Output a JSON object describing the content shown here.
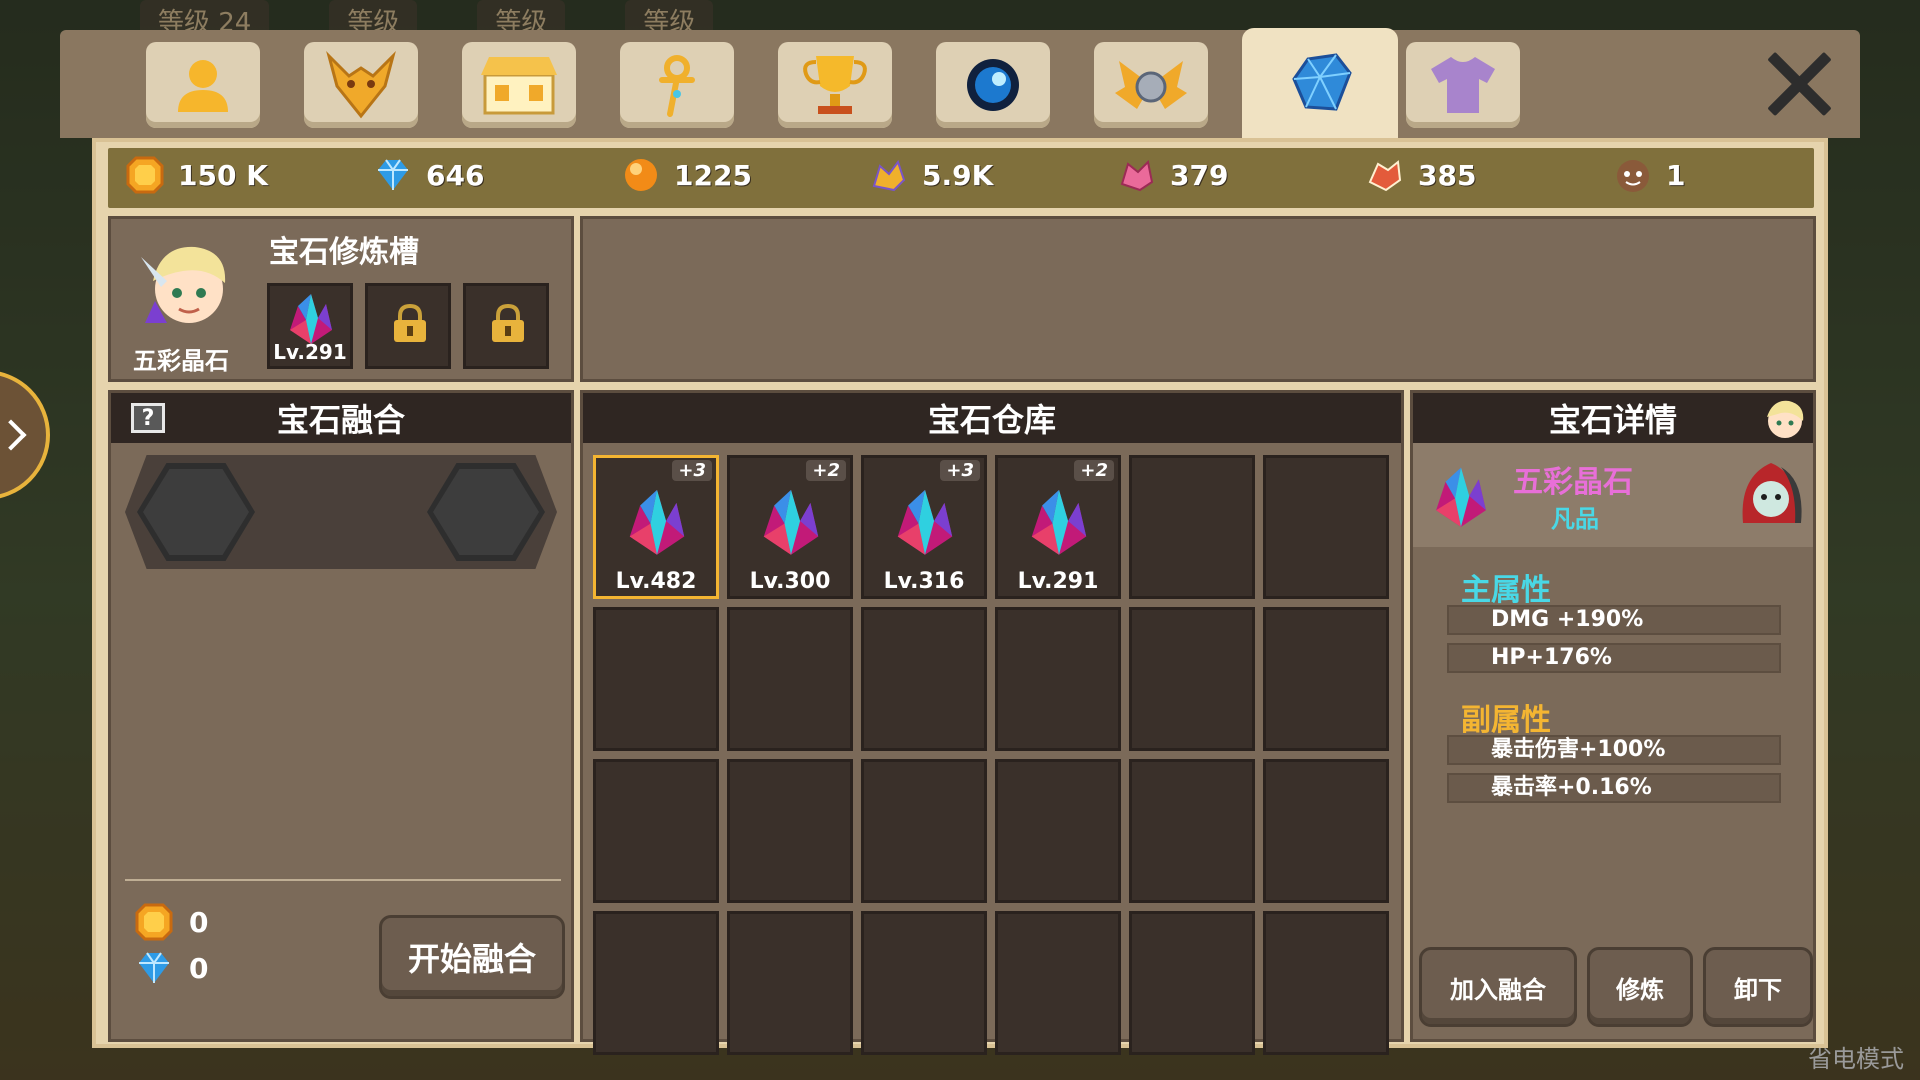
{
  "background": {
    "hud_labels": [
      "等级 24",
      "等级",
      "等级",
      "等级"
    ],
    "watermark": "省电模式"
  },
  "tabs": [
    {
      "name": "character",
      "icon": "person-icon",
      "active": false
    },
    {
      "name": "pet",
      "icon": "dragon-head-icon",
      "active": false
    },
    {
      "name": "shop",
      "icon": "shop-icon",
      "active": false
    },
    {
      "name": "skill",
      "icon": "ankh-staff-icon",
      "active": false
    },
    {
      "name": "trophy",
      "icon": "trophy-icon",
      "active": false
    },
    {
      "name": "orb",
      "icon": "blue-orb-icon",
      "active": false
    },
    {
      "name": "wings",
      "icon": "golden-wings-icon",
      "active": false
    },
    {
      "name": "gem",
      "icon": "blue-gem-icon",
      "active": true
    },
    {
      "name": "outfit",
      "icon": "shirt-icon",
      "active": false
    }
  ],
  "resources": [
    {
      "icon": "gold-coin-icon",
      "value": "150 K"
    },
    {
      "icon": "diamond-icon",
      "value": "646"
    },
    {
      "icon": "orange-orb-icon",
      "value": "1225"
    },
    {
      "icon": "gold-creature-icon",
      "value": "5.9K"
    },
    {
      "icon": "pink-creature-icon",
      "value": "379"
    },
    {
      "icon": "red-creature-icon",
      "value": "385"
    },
    {
      "icon": "pet-face-icon",
      "value": "1"
    }
  ],
  "slot_panel": {
    "title": "宝石修炼槽",
    "hero_name": "五彩晶石",
    "slots": [
      {
        "state": "gem",
        "level": "Lv.291"
      },
      {
        "state": "locked"
      },
      {
        "state": "locked"
      }
    ]
  },
  "fusion": {
    "help": "?",
    "title": "宝石融合",
    "gold_cost": "0",
    "diamond_cost": "0",
    "start_button": "开始融合"
  },
  "warehouse": {
    "title": "宝石仓库",
    "items": [
      {
        "plus": "+3",
        "level": "Lv.482",
        "selected": true
      },
      {
        "plus": "+2",
        "level": "Lv.300",
        "selected": false
      },
      {
        "plus": "+3",
        "level": "Lv.316",
        "selected": false
      },
      {
        "plus": "+2",
        "level": "Lv.291",
        "selected": false
      }
    ],
    "total_cells": 24
  },
  "details": {
    "title": "宝石详情",
    "gem_name": "五彩晶石",
    "quality": "凡品",
    "main_attr_title": "主属性",
    "main_attrs": [
      "DMG +190%",
      "HP+176%"
    ],
    "sub_attr_title": "副属性",
    "sub_attrs": [
      "暴击伤害+100%",
      "暴击率+0.16%"
    ],
    "buttons": [
      "加入融合",
      "修炼",
      "卸下"
    ]
  },
  "colors": {
    "accent_gold": "#f4b532",
    "gem_name": "#e86fd8",
    "quality": "#49d8e6",
    "main_attr": "#49d8e6",
    "sub_attr": "#f4b532"
  }
}
